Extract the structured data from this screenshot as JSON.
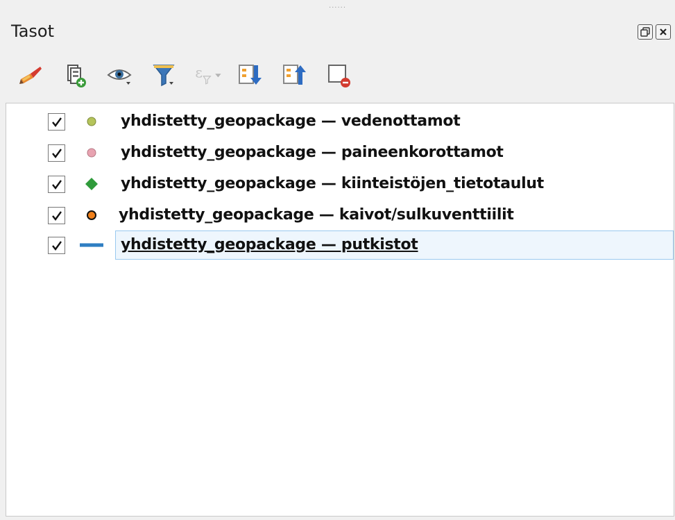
{
  "panel": {
    "title": "Tasot",
    "grip": "......"
  },
  "toolbar": {
    "tools": [
      {
        "icon": "style-brush-icon"
      },
      {
        "icon": "add-group-icon"
      },
      {
        "icon": "visibility-eye-icon"
      },
      {
        "icon": "filter-legend-icon"
      },
      {
        "icon": "filter-expression-icon"
      },
      {
        "icon": "expand-all-icon"
      },
      {
        "icon": "collapse-all-icon"
      },
      {
        "icon": "remove-layer-icon"
      }
    ]
  },
  "layers": [
    {
      "label": "yhdistetty_geopackage — vedenottamot",
      "checked": true,
      "symbol": "circle",
      "color": "#b5c45b"
    },
    {
      "label": "yhdistetty_geopackage — paineenkorottamot",
      "checked": true,
      "symbol": "circle",
      "color": "#e8a3b1"
    },
    {
      "label": "yhdistetty_geopackage — kiinteistöjen_tietotaulut",
      "checked": true,
      "symbol": "diamond",
      "color": "#2f9b3b"
    },
    {
      "label": "yhdistetty_geopackage — kaivot/sulkuventtiilit",
      "checked": true,
      "symbol": "circle",
      "color": "#ef7f1a"
    },
    {
      "label": "yhdistetty_geopackage — putkistot",
      "checked": true,
      "symbol": "line",
      "color": "#2f7ec2",
      "selected": true
    }
  ]
}
